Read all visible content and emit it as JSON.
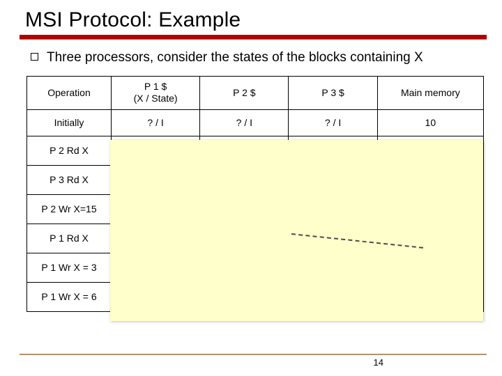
{
  "title": "MSI Protocol: Example",
  "bullet": "Three processors, consider the states of the blocks containing X",
  "table": {
    "headers": {
      "op": "Operation",
      "p1": "P 1 $",
      "p1_sub": "(X / State)",
      "p2": "P 2 $",
      "p3": "P 3 $",
      "mm": "Main memory"
    },
    "rows": [
      {
        "op": "Initially",
        "p1": "? / I",
        "p2": "? / I",
        "p3": "? / I",
        "mm": "10"
      },
      {
        "op": "P 2 Rd X",
        "p1": "",
        "p2": "",
        "p3": "",
        "mm": ""
      },
      {
        "op": "P 3 Rd X",
        "p1": "",
        "p2": "",
        "p3": "",
        "mm": ""
      },
      {
        "op": "P 2 Wr X=15",
        "p1": "",
        "p2": "",
        "p3": "",
        "mm": ""
      },
      {
        "op": "P 1 Rd X",
        "p1": "",
        "p2": "",
        "p3": "",
        "mm": ""
      },
      {
        "op": "P 1 Wr X = 3",
        "p1": "",
        "p2": "",
        "p3": "",
        "mm": ""
      },
      {
        "op": "P 1 Wr X = 6",
        "p1": "",
        "p2": "",
        "p3": "",
        "mm": ""
      }
    ]
  },
  "page_number": "14"
}
